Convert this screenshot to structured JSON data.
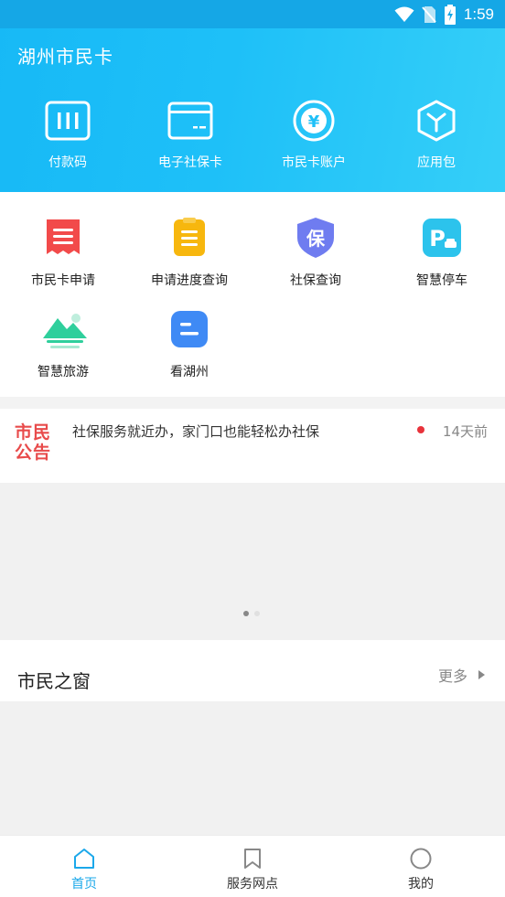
{
  "status_bar": {
    "time": "1:59",
    "icons": [
      "wifi-icon",
      "no-sim-icon",
      "battery-charging-icon"
    ]
  },
  "header": {
    "title": "湖州市民卡"
  },
  "quick_actions": [
    {
      "label": "付款码",
      "icon": "barcode-icon"
    },
    {
      "label": "电子社保卡",
      "icon": "card-icon"
    },
    {
      "label": "市民卡账户",
      "icon": "yuan-icon"
    },
    {
      "label": "应用包",
      "icon": "box-icon"
    }
  ],
  "services": [
    {
      "label": "市民卡申请",
      "icon": "receipt-icon",
      "color": "#f24a4a"
    },
    {
      "label": "申请进度查询",
      "icon": "clipboard-icon",
      "color": "#f7b70e"
    },
    {
      "label": "社保查询",
      "icon": "shield-bao-icon",
      "color": "#6f7cf0"
    },
    {
      "label": "智慧停车",
      "icon": "parking-icon",
      "color": "#2cc3ec"
    },
    {
      "label": "智慧旅游",
      "icon": "mountain-icon",
      "color": "#2fcf9c"
    },
    {
      "label": "看湖州",
      "icon": "news-icon",
      "color": "#3f8af5"
    }
  ],
  "notice": {
    "logo_line1": "市民",
    "logo_line2": "公告",
    "text": "社保服务就近办，家门口也能轻松办社保",
    "time": "14天前"
  },
  "banner": {
    "slide_count": 2,
    "active_slide": 1
  },
  "window_section": {
    "title": "市民之窗",
    "more_label": "更多"
  },
  "tabs": [
    {
      "label": "首页",
      "icon": "home-icon",
      "active": true
    },
    {
      "label": "服务网点",
      "icon": "bookmark-icon",
      "active": false
    },
    {
      "label": "我的",
      "icon": "user-circle-icon",
      "active": false
    }
  ],
  "colors": {
    "accent": "#1ba8ea",
    "header_start": "#17b9f6",
    "header_end": "#35cff8",
    "notice_red": "#e84b4b"
  }
}
